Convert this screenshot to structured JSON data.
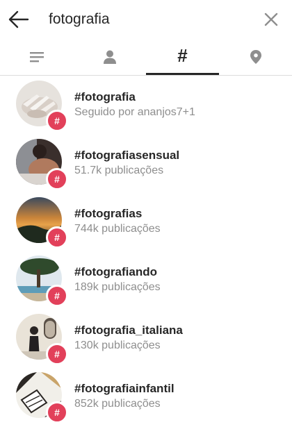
{
  "search": {
    "query": "fotografia"
  },
  "tabs": [
    {
      "icon": "top-icon"
    },
    {
      "icon": "person-icon"
    },
    {
      "label": "#",
      "icon": "hashtag-icon",
      "active": true
    },
    {
      "icon": "location-pin-icon"
    }
  ],
  "results": [
    {
      "name": "#fotografia",
      "subtitle": "Seguido por ananjos7+1"
    },
    {
      "name": "#fotografiasensual",
      "subtitle": "51.7k publicações"
    },
    {
      "name": "#fotografias",
      "subtitle": "744k publicações"
    },
    {
      "name": "#fotografiando",
      "subtitle": "189k publicações"
    },
    {
      "name": "#fotografia_italiana",
      "subtitle": "130k publicações"
    },
    {
      "name": "#fotografiainfantil",
      "subtitle": "852k publicações"
    }
  ],
  "badge_glyph": "#",
  "colors": {
    "badge": "#e2405a",
    "secondary_text": "#8e8e8e",
    "icon_gray": "#8e8e8e"
  }
}
